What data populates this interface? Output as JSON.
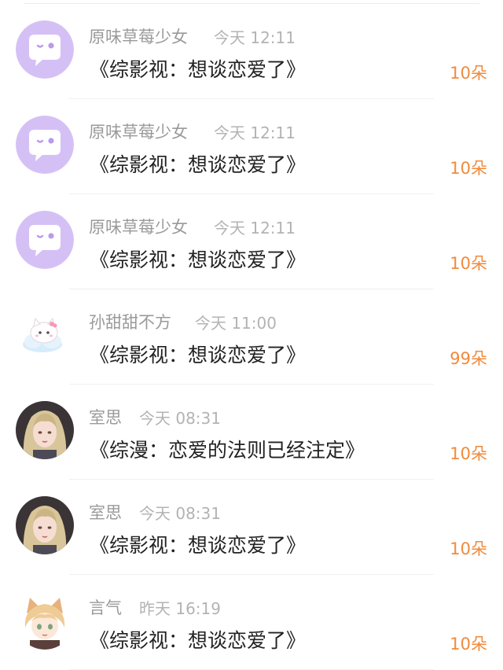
{
  "colors": {
    "accent": "#f08a3c",
    "name_gray": "#9a9a9a",
    "time_gray": "#b3b3b3",
    "title_text": "#222222",
    "default_avatar_bg": "#d5c0f6"
  },
  "items": [
    {
      "avatar": "default-chat-bubble-avatar",
      "name": "原味草莓少女",
      "time": "今天 12:11",
      "title": "《综影视：想谈恋爱了》",
      "count": "10朵"
    },
    {
      "avatar": "default-chat-bubble-avatar",
      "name": "原味草莓少女",
      "time": "今天 12:11",
      "title": "《综影视：想谈恋爱了》",
      "count": "10朵"
    },
    {
      "avatar": "default-chat-bubble-avatar",
      "name": "原味草莓少女",
      "time": "今天 12:11",
      "title": "《综影视：想谈恋爱了》",
      "count": "10朵"
    },
    {
      "avatar": "cloud-cat-avatar",
      "name": "孙甜甜不方",
      "time": "今天 11:00",
      "title": "《综影视：想谈恋爱了》",
      "count": "99朵"
    },
    {
      "avatar": "anime-girl-avatar",
      "name": "室思",
      "time": "今天 08:31",
      "title": "《综漫：恋爱的法则已经注定》",
      "count": "10朵"
    },
    {
      "avatar": "anime-girl-avatar",
      "name": "室思",
      "time": "今天 08:31",
      "title": "《综影视：想谈恋爱了》",
      "count": "10朵"
    },
    {
      "avatar": "fox-ear-boy-avatar",
      "name": "言气",
      "time": "昨天 16:19",
      "title": "《综影视：想谈恋爱了》",
      "count": "10朵"
    }
  ]
}
